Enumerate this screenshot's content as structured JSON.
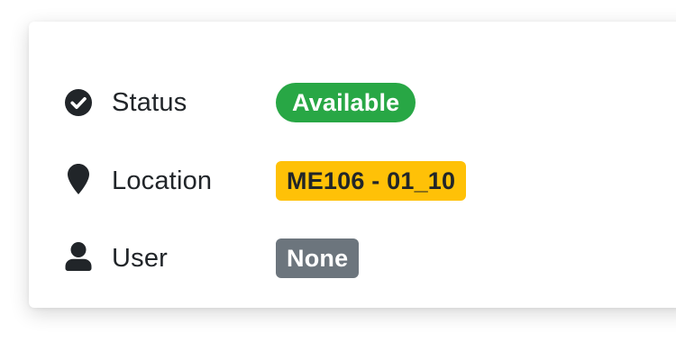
{
  "fields": [
    {
      "icon": "check-circle-icon",
      "label": "Status",
      "value": "Available",
      "badge_color": "#28a745"
    },
    {
      "icon": "map-marker-icon",
      "label": "Location",
      "value": "ME106 - 01_10",
      "badge_color": "#ffc107"
    },
    {
      "icon": "user-icon",
      "label": "User",
      "value": "None",
      "badge_color": "#6c757d"
    }
  ],
  "colors": {
    "text": "#212529",
    "card_background": "#ffffff"
  }
}
